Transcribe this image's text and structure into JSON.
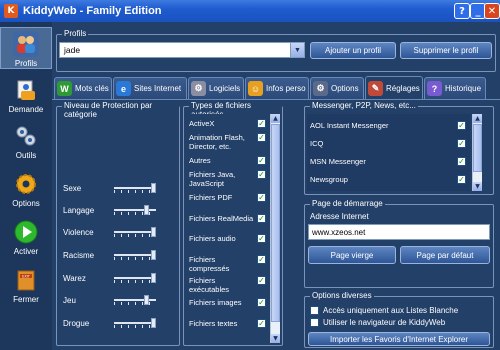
{
  "window": {
    "title": "KiddyWeb - Family Edition"
  },
  "sidebar": {
    "items": [
      {
        "label": "Profils",
        "icon": "people-icon"
      },
      {
        "label": "Demande",
        "icon": "request-icon"
      },
      {
        "label": "Outils",
        "icon": "tools-icon"
      },
      {
        "label": "Options",
        "icon": "gear-icon"
      },
      {
        "label": "Activer",
        "icon": "play-icon"
      },
      {
        "label": "Fermer",
        "icon": "exit-icon"
      }
    ]
  },
  "profile": {
    "group_title": "Profils",
    "selected": "jade",
    "add_button": "Ajouter un profil",
    "delete_button": "Supprimer le profil"
  },
  "tabs": [
    {
      "label": "Mots clés",
      "icon": "W"
    },
    {
      "label": "Sites Internet",
      "icon": "e"
    },
    {
      "label": "Logiciels",
      "icon": "⚙"
    },
    {
      "label": "Infos perso",
      "icon": "☺"
    },
    {
      "label": "Options",
      "icon": "⚙"
    },
    {
      "label": "Réglages",
      "icon": "✎"
    },
    {
      "label": "Historique",
      "icon": "?"
    }
  ],
  "protection": {
    "title": "Niveau de Protection par catégorie",
    "categories": [
      {
        "label": "Sexe",
        "level": 1.0
      },
      {
        "label": "Langage",
        "level": 0.8
      },
      {
        "label": "Violence",
        "level": 1.0
      },
      {
        "label": "Racisme",
        "level": 1.0
      },
      {
        "label": "Warez",
        "level": 1.0
      },
      {
        "label": "Jeu",
        "level": 0.8
      },
      {
        "label": "Drogue",
        "level": 1.0
      }
    ]
  },
  "filetypes": {
    "title": "Types de fichiers autorisés",
    "items": [
      {
        "label": "ActiveX",
        "checked": true
      },
      {
        "label": "Animation Flash, Director, etc.",
        "checked": true
      },
      {
        "label": "Autres",
        "checked": true
      },
      {
        "label": "Fichiers Java, JavaScript",
        "checked": true
      },
      {
        "label": "Fichiers PDF",
        "checked": true
      },
      {
        "label": "Fichiers RealMedia",
        "checked": true
      },
      {
        "label": "Fichiers audio",
        "checked": true
      },
      {
        "label": "Fichiers compressés",
        "checked": true
      },
      {
        "label": "Fichiers exécutables",
        "checked": true
      },
      {
        "label": "Fichiers images",
        "checked": true
      },
      {
        "label": "Fichiers textes",
        "checked": true
      }
    ]
  },
  "messenger": {
    "title": "Messenger, P2P, News, etc...",
    "items": [
      {
        "label": "AOL Instant Messenger",
        "checked": true
      },
      {
        "label": "ICQ",
        "checked": true
      },
      {
        "label": "MSN Messenger",
        "checked": true
      },
      {
        "label": "Newsgroup",
        "checked": true
      }
    ]
  },
  "startpage": {
    "title": "Page de démarrage",
    "address_label": "Adresse Internet",
    "address_value": "www.xzeos.net",
    "blank_button": "Page vierge",
    "default_button": "Page par défaut"
  },
  "misc": {
    "title": "Options diverses",
    "option1": "Accès uniquement aux Listes Blanche",
    "option1_checked": false,
    "option2": "Utiliser le navigateur de KiddyWeb",
    "option2_checked": false,
    "import_button": "Importer les Favoris d'Internet Explorer"
  }
}
